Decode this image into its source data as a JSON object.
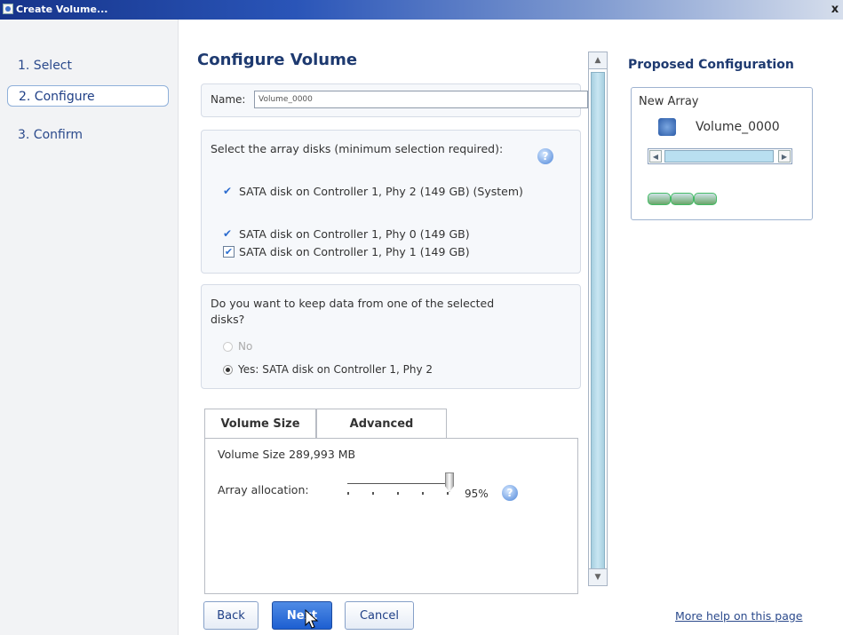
{
  "window": {
    "title": "Create Volume...",
    "close_glyph": "x"
  },
  "steps": [
    {
      "label": "1. Select"
    },
    {
      "label": "2. Configure"
    },
    {
      "label": "3. Confirm"
    }
  ],
  "main": {
    "title": "Configure Volume",
    "name_label": "Name:",
    "name_value": "Volume_0000",
    "disk_prompt": "Select the array disks (minimum selection required):",
    "disks": [
      {
        "label": "SATA disk on Controller 1, Phy 2 (149 GB) (System)",
        "checked": true
      },
      {
        "label": "SATA disk on Controller 1, Phy 0 (149 GB)",
        "checked": true
      },
      {
        "label": "SATA disk on Controller 1, Phy 1 (149 GB)",
        "checked": true
      }
    ],
    "keep_question": "Do you want to keep data from one of the selected disks?",
    "keep_options": [
      {
        "label": "No",
        "selected": false,
        "enabled": false
      },
      {
        "label": "Yes: SATA disk on Controller 1, Phy 2",
        "selected": true,
        "enabled": true
      }
    ],
    "tabs": [
      {
        "label": "Volume Size"
      },
      {
        "label": "Advanced"
      }
    ],
    "volume_size_text": "Volume Size 289,993 MB",
    "array_allocation_label": "Array allocation:",
    "array_allocation_value": "95%",
    "array_allocation_fraction": 0.95
  },
  "proposed": {
    "title": "Proposed Configuration",
    "array_label": "New Array",
    "volume_name": "Volume_0000"
  },
  "buttons": {
    "back": "Back",
    "next": "Next",
    "cancel": "Cancel"
  },
  "help_link": "More help on this page",
  "icons": {
    "help": "help-question-icon",
    "volume": "volume-disk-icon",
    "disk": "hard-disk-icon"
  }
}
